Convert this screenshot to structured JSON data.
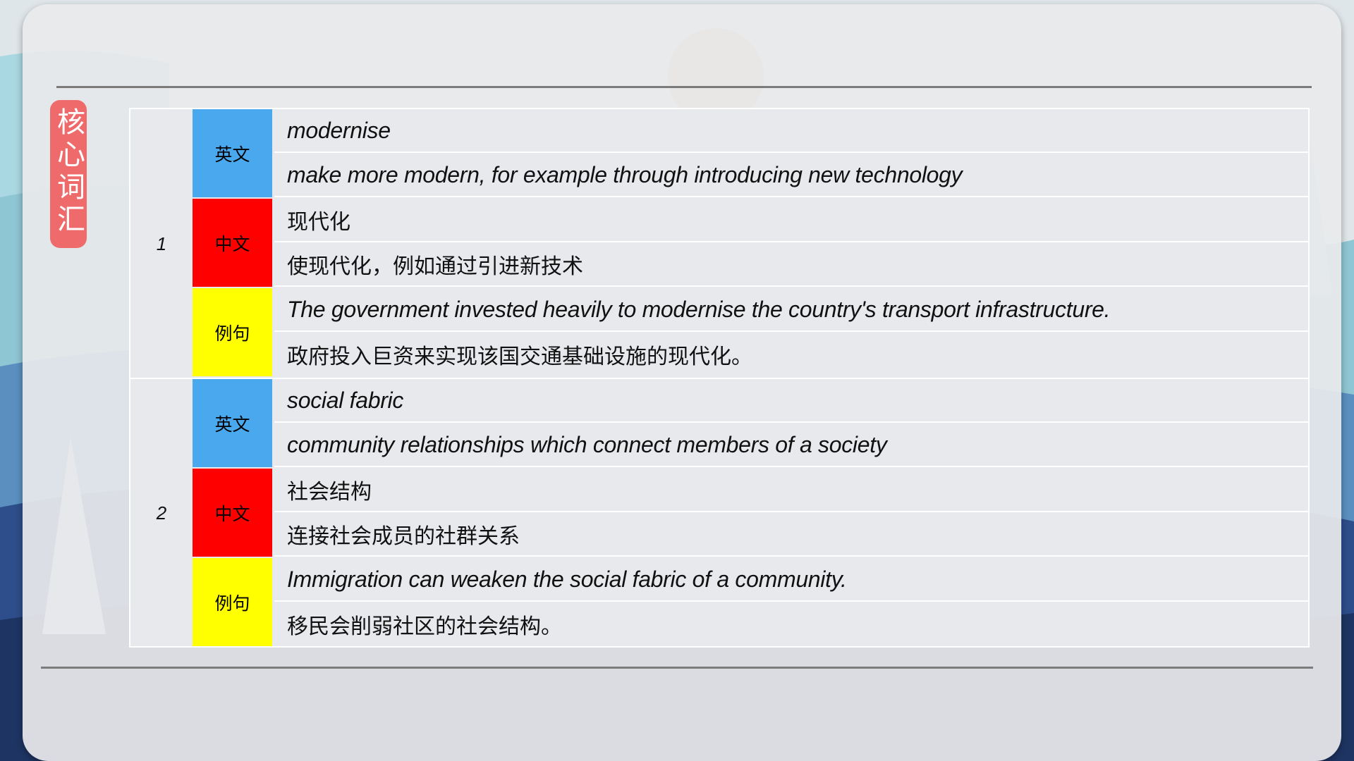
{
  "side_label": "核心词汇",
  "entries": [
    {
      "number": "1",
      "english_tag": "英文",
      "chinese_tag": "中文",
      "example_tag": "例句",
      "word": "modernise",
      "definition": "make more modern, for example through introducing new technology",
      "chinese_word": "现代化",
      "chinese_definition": "使现代化，例如通过引进新技术",
      "example": "The government invested heavily to modernise the country's transport infrastructure.",
      "example_translation": "政府投入巨资来实现该国交通基础设施的现代化。"
    },
    {
      "number": "2",
      "english_tag": "英文",
      "chinese_tag": "中文",
      "example_tag": "例句",
      "word": "social fabric",
      "definition": "community relationships which connect members of a society",
      "chinese_word": "社会结构",
      "chinese_definition": "连接社会成员的社群关系",
      "example": "Immigration can weaken the social fabric of a community.",
      "example_translation": "移民会削弱社区的社会结构。"
    }
  ],
  "colors": {
    "english_tag": "#4aa8ef",
    "chinese_tag": "#ff0000",
    "example_tag": "#ffff00",
    "side_label": "#ef6b6b"
  }
}
